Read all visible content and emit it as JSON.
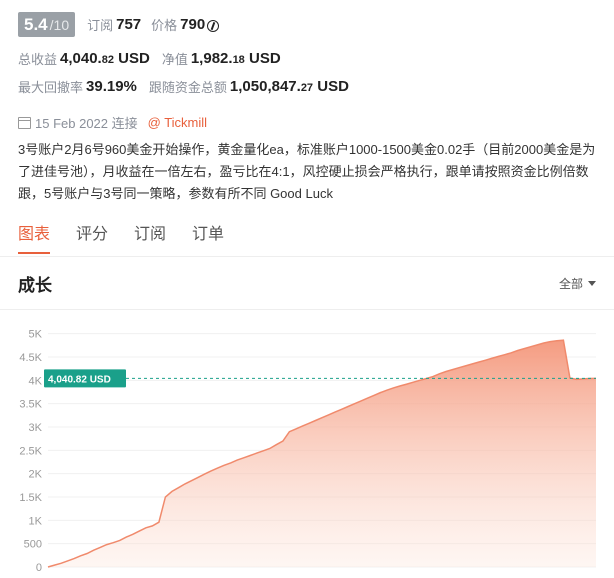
{
  "header": {
    "rating": "5.4",
    "rating_max": "/10",
    "subscribe_label": "订阅",
    "subscribe_count": "757",
    "price_label": "价格",
    "price_value": "790"
  },
  "stats": {
    "total_profit_label": "总收益",
    "total_profit_int": "4,040.",
    "total_profit_dec": "82",
    "total_profit_unit": " USD",
    "net_label": "净值",
    "net_int": "1,982.",
    "net_dec": "18",
    "net_unit": " USD",
    "drawdown_label": "最大回撤率",
    "drawdown_value": "39.19%",
    "follow_label": "跟随资金总额",
    "follow_int": "1,050,847.",
    "follow_dec": "27",
    "follow_unit": " USD"
  },
  "meta": {
    "date": "15 Feb 2022 连接",
    "broker": "@ Tickmill"
  },
  "description": "3号账户2月6号960美金开始操作，黄金量化ea，标准账户1000-1500美金0.02手（目前2000美金是为了进佳号池），月收益在一倍左右，盈亏比在4:1，风控硬止损会严格执行，跟单请按照资金比例倍数跟，5号账户与3号同一策略，参数有所不同   Good Luck",
  "tabs": [
    "图表",
    "评分",
    "订阅",
    "订单"
  ],
  "growth": {
    "title": "成长",
    "range_label": "全部"
  },
  "colors": {
    "accent": "#e8603c",
    "line": "#f08a6c",
    "marker": "#1aa08a",
    "badge": "#9aa0a6"
  },
  "chart_data": {
    "type": "area",
    "y_ticks": [
      "0",
      "500",
      "1K",
      "1.5K",
      "2K",
      "2.5K",
      "3K",
      "3.5K",
      "4K",
      "4.5K",
      "5K"
    ],
    "ylim": [
      0,
      5250
    ],
    "grid": true,
    "current_value_label": "4,040.82 USD",
    "current_value": 4040.82,
    "x": [
      0,
      1,
      2,
      3,
      4,
      5,
      6,
      7,
      8,
      9,
      10,
      11,
      12,
      13,
      14,
      15,
      16,
      17,
      18,
      19,
      20,
      21,
      22,
      23,
      24,
      25,
      26,
      27,
      28,
      29,
      30,
      31,
      32,
      33,
      34,
      35,
      36,
      37,
      38,
      39,
      40,
      41,
      42,
      43,
      44,
      45,
      46,
      47,
      48,
      49,
      50,
      51,
      52,
      53,
      54,
      55,
      56,
      57,
      58,
      59,
      60,
      61,
      62,
      63,
      64,
      65,
      66,
      67,
      68,
      69,
      70,
      71,
      72,
      73,
      74,
      75,
      76,
      77,
      78,
      79,
      80,
      81,
      82,
      83,
      84,
      85,
      86,
      87,
      88,
      89,
      90,
      91,
      92,
      93,
      94,
      95,
      96,
      97,
      98,
      99,
      100
    ],
    "values": [
      0,
      40,
      80,
      130,
      180,
      240,
      290,
      360,
      420,
      480,
      520,
      570,
      640,
      700,
      770,
      840,
      880,
      960,
      1500,
      1620,
      1700,
      1780,
      1850,
      1920,
      1990,
      2060,
      2120,
      2180,
      2230,
      2290,
      2340,
      2390,
      2440,
      2490,
      2540,
      2620,
      2700,
      2900,
      2960,
      3020,
      3080,
      3140,
      3200,
      3260,
      3320,
      3380,
      3440,
      3500,
      3560,
      3620,
      3680,
      3740,
      3790,
      3840,
      3880,
      3920,
      3960,
      4000,
      4040,
      4080,
      4140,
      4190,
      4230,
      4270,
      4310,
      4350,
      4390,
      4430,
      4470,
      4510,
      4550,
      4590,
      4640,
      4680,
      4720,
      4760,
      4800,
      4830,
      4850,
      4860,
      4050,
      4020,
      4030,
      4040,
      4040.82
    ]
  }
}
